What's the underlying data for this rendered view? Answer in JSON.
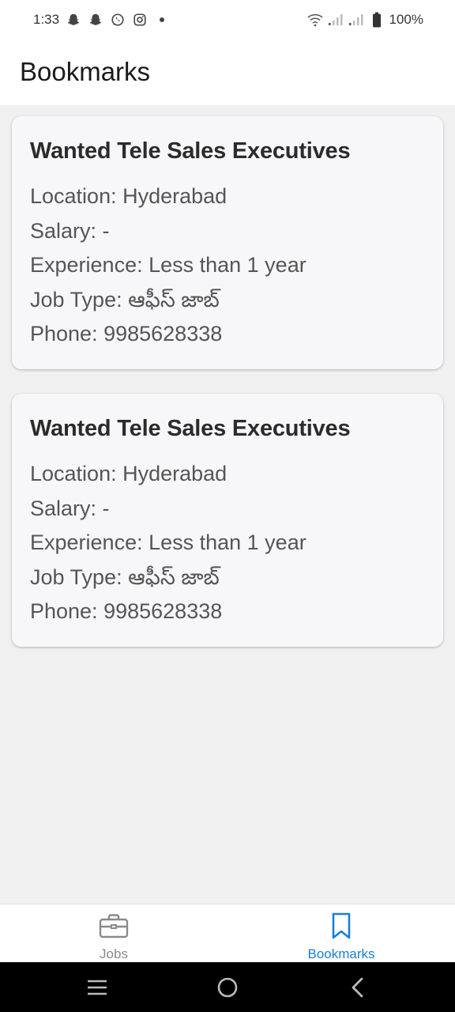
{
  "status_bar": {
    "time": "1:33",
    "battery": "100%",
    "left_icons": [
      "snapchat-icon",
      "snapchat-icon",
      "whatsapp-icon",
      "instagram-icon",
      "dot-icon"
    ],
    "right_icons": [
      "wifi-icon",
      "signal-icon",
      "signal-icon",
      "battery-icon"
    ]
  },
  "header": {
    "title": "Bookmarks"
  },
  "bookmarks": [
    {
      "title": "Wanted Tele Sales Executives",
      "location": "Location: Hyderabad",
      "salary": "Salary: -",
      "experience": "Experience: Less than 1 year",
      "job_type": "Job Type: ఆఫీస్ జాబ్",
      "phone": "Phone: 9985628338"
    },
    {
      "title": "Wanted Tele Sales Executives",
      "location": "Location: Hyderabad",
      "salary": "Salary: -",
      "experience": "Experience: Less than 1 year",
      "job_type": "Job Type: ఆఫీస్ జాబ్",
      "phone": "Phone: 9985628338"
    }
  ],
  "bottom_nav": {
    "items": [
      {
        "label": "Jobs",
        "icon": "briefcase-icon",
        "active": false
      },
      {
        "label": "Bookmarks",
        "icon": "bookmark-icon",
        "active": true
      }
    ],
    "active_color": "#1a7fd4",
    "inactive_color": "#8a8a8a"
  },
  "system_nav": {
    "icons": [
      "menu-icon",
      "home-icon",
      "back-icon"
    ]
  }
}
